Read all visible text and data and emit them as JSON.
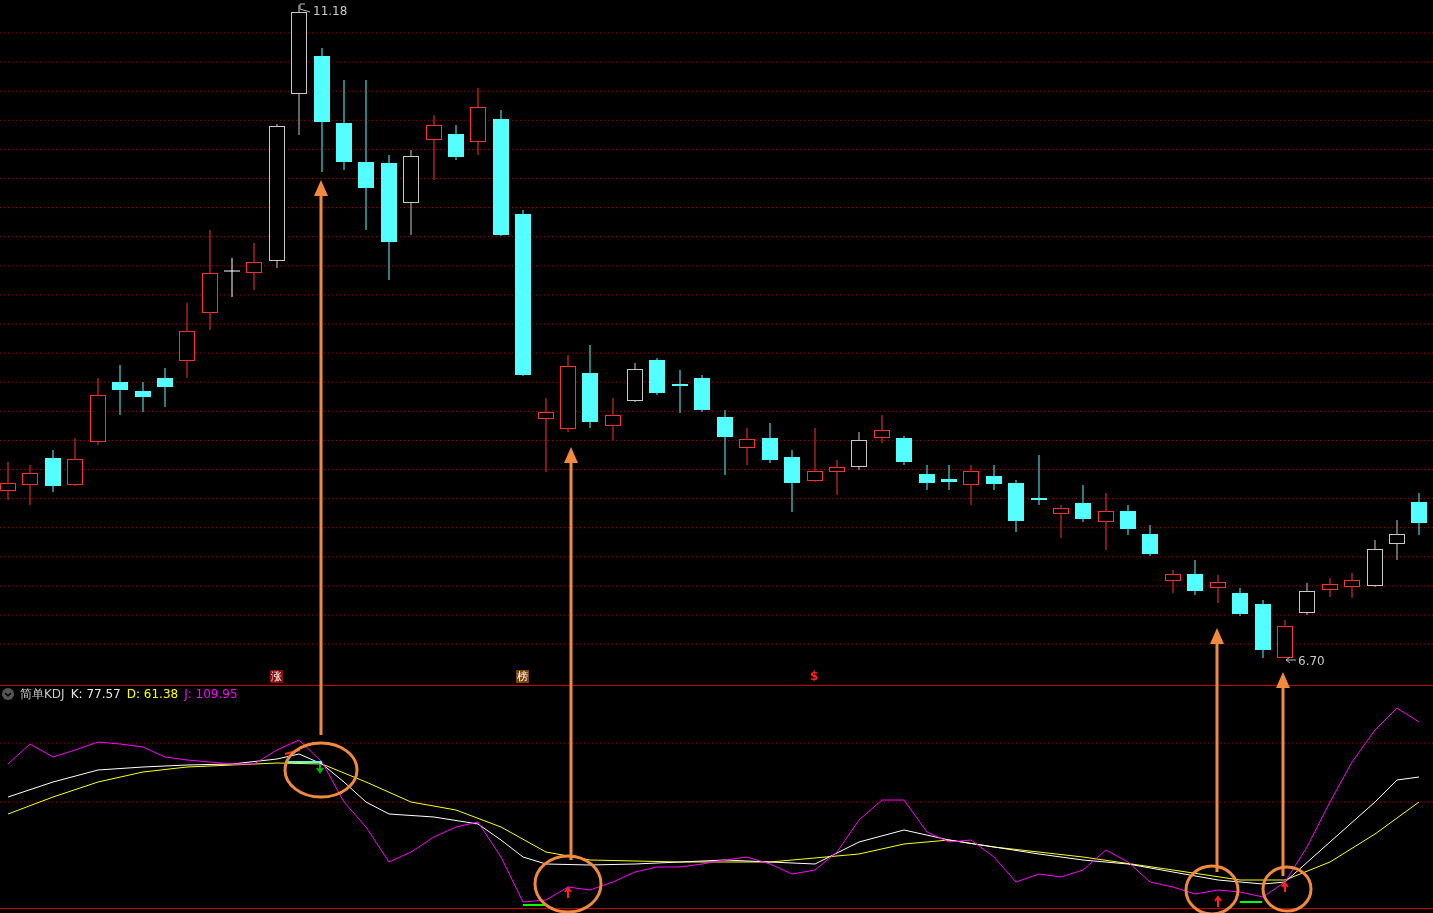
{
  "price_panel": {
    "high_label": "11.18",
    "low_label": "6.70",
    "markers": [
      {
        "kind": "badge",
        "text": "涨",
        "color": "#8b0a0a"
      },
      {
        "kind": "badge",
        "text": "榜",
        "color": "#7a4506"
      },
      {
        "kind": "plain",
        "text": "$",
        "color": "#ff2020"
      }
    ]
  },
  "indicator": {
    "name": "简单KDJ",
    "values": [
      {
        "label": "K: 77.57",
        "color": "#e6e6e6"
      },
      {
        "label": "D: 61.38",
        "color": "#ffff00"
      },
      {
        "label": "J: 109.95",
        "color": "#ff00ff"
      }
    ]
  }
}
